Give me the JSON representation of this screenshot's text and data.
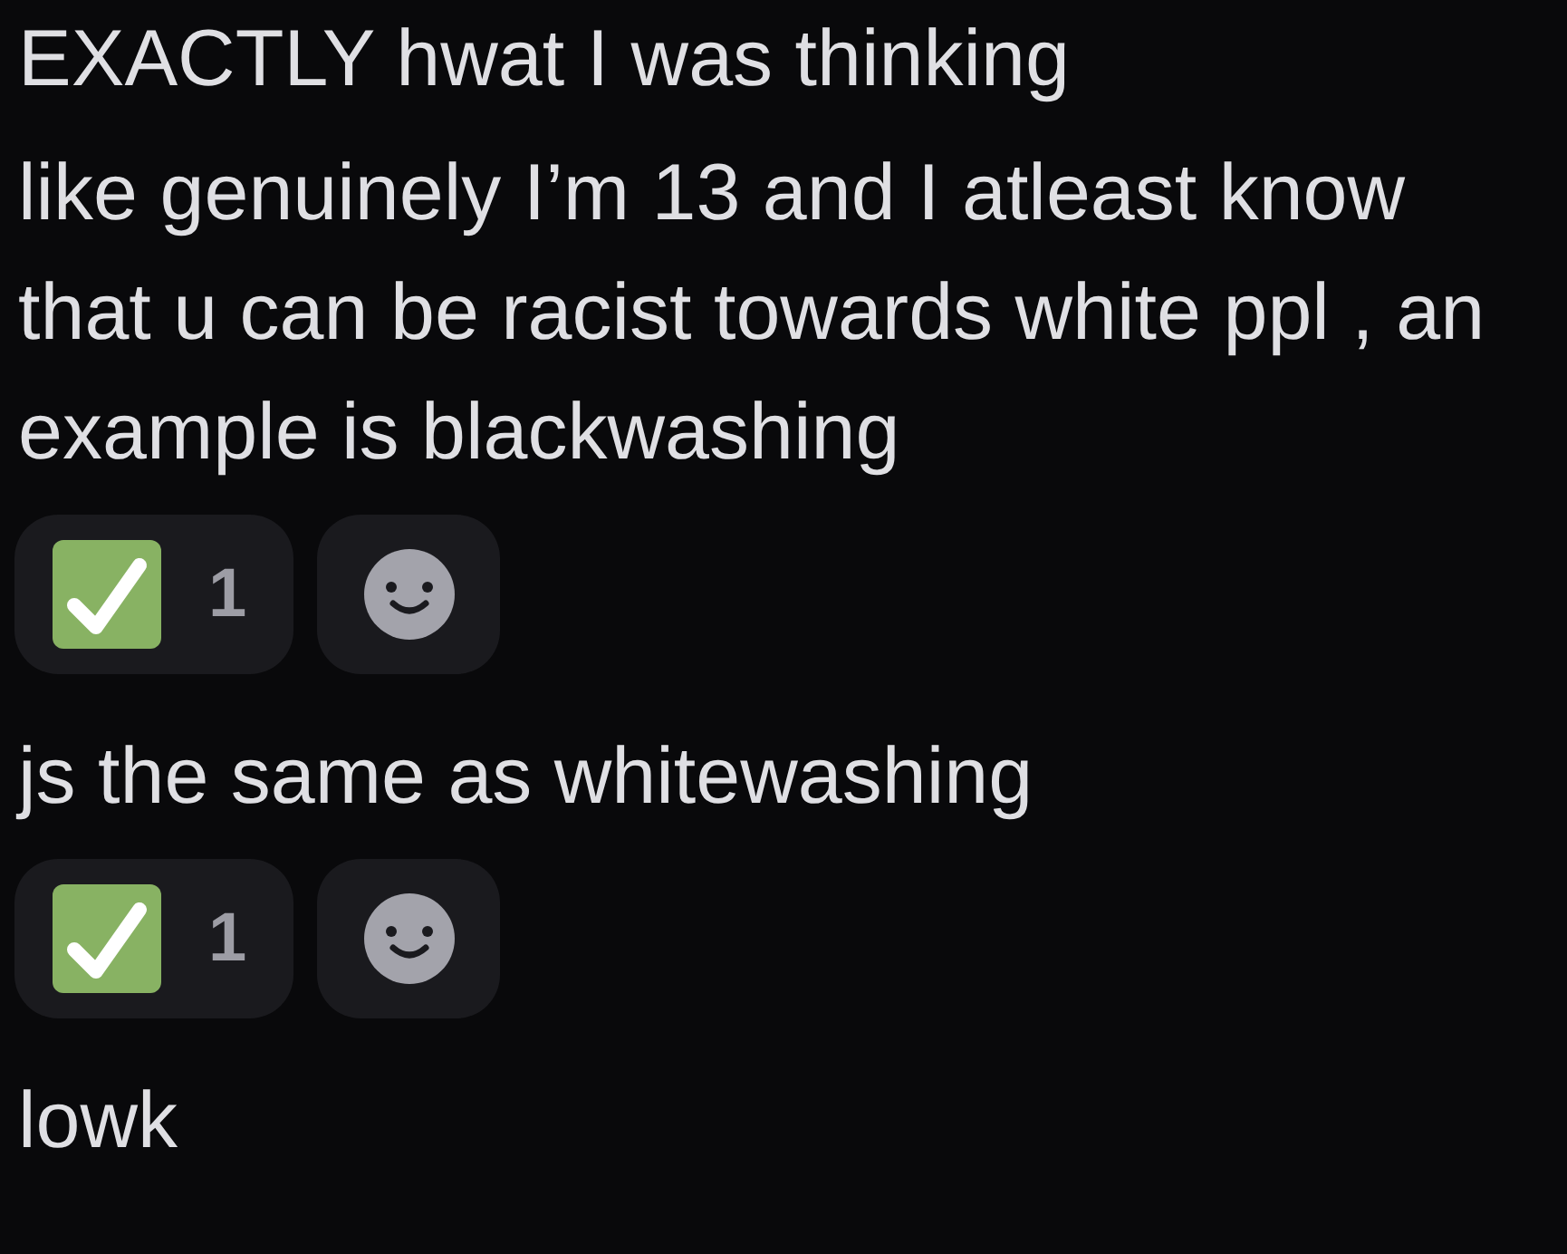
{
  "messages": [
    {
      "text": "EXACTLY hwat I was thinking"
    },
    {
      "text": "like genuinely I’m 13 and I atleast know that u can be racist towards white ppl , an example is blackwashing",
      "reactions": [
        {
          "count": "1"
        }
      ]
    },
    {
      "text": "js the same as whitewashing",
      "reactions": [
        {
          "count": "1"
        }
      ]
    },
    {
      "text": "lowk"
    }
  ]
}
